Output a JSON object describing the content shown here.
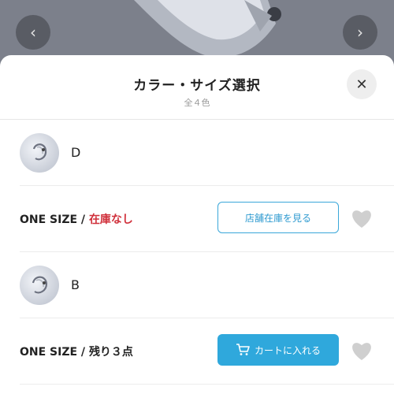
{
  "sheet": {
    "title": "カラー・サイズ選択",
    "subtitle": "全４色"
  },
  "variants": [
    {
      "color": "D",
      "size_label": "ONE SIZE /",
      "stock_text": "在庫なし",
      "stock_color": "#d0303b",
      "action_label": "店舗在庫を見る",
      "action_icon": "none"
    },
    {
      "color": "B",
      "size_label": "ONE SIZE /",
      "stock_text": "残り３点",
      "stock_color": "#222222",
      "action_label": "カートに入れる",
      "action_icon": "cart-icon"
    }
  ],
  "colors": {
    "accent": "#2fa8dc",
    "out_of_stock": "#d0303b"
  },
  "icons": {
    "close": "close-icon",
    "prev": "chevron-left-icon",
    "next": "chevron-right-icon",
    "favorite": "heart-icon",
    "cart": "cart-icon"
  }
}
